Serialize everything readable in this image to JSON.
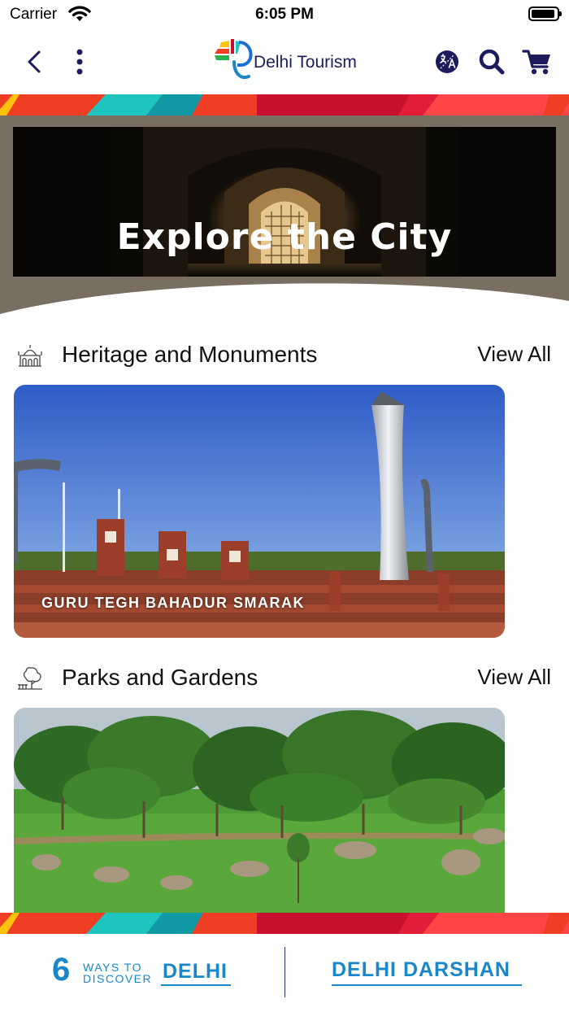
{
  "status_bar": {
    "carrier": "Carrier",
    "time": "6:05 PM"
  },
  "header": {
    "logo_text": "Delhi Tourism",
    "icons": [
      "back-icon",
      "more-vertical-icon",
      "language-icon",
      "search-icon",
      "cart-icon"
    ],
    "icon_color": "#1c1c5c"
  },
  "hero": {
    "title": "Explore the City"
  },
  "sections": [
    {
      "title": "Heritage and Monuments",
      "view_all": "View All",
      "icon": "monument-icon",
      "card_label": "GURU TEGH BAHADUR SMARAK"
    },
    {
      "title": "Parks and Gardens",
      "view_all": "View All",
      "icon": "park-icon"
    }
  ],
  "bottom_bar": {
    "six_ways": {
      "number": "6",
      "line1": "WAYS TO",
      "line2": "DISCOVER",
      "city": "DELHI"
    },
    "darshan": "DELHI DARSHAN",
    "accent_color": "#1a87c9"
  },
  "stripe_colors": [
    "#ef3e24",
    "#1ec4be",
    "#119aa6",
    "#c8102e",
    "#ff4545"
  ]
}
